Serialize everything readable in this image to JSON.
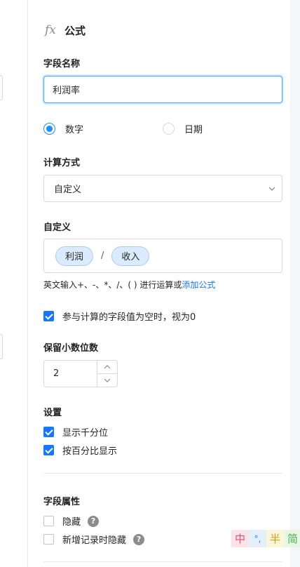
{
  "header": {
    "icon": "fx-icon",
    "fx_text": "fx",
    "title": "公式"
  },
  "field_name": {
    "label": "字段名称",
    "value": "利润率"
  },
  "type_options": [
    {
      "label": "数字",
      "selected": true
    },
    {
      "label": "日期",
      "selected": false
    }
  ],
  "calc": {
    "label": "计算方式",
    "value": "自定义"
  },
  "custom": {
    "label": "自定义",
    "tokens": [
      "利润",
      "收入"
    ],
    "operator": "/",
    "hint": "英文输入+、-、*、/、( ) 进行运算或",
    "hint_link": "添加公式"
  },
  "empty_as_zero": {
    "label": "参与计算的字段值为空时，视为0",
    "checked": true
  },
  "decimals": {
    "label": "保留小数位数",
    "value": "2"
  },
  "settings": {
    "label": "设置",
    "items": [
      {
        "label": "显示千分位",
        "checked": true
      },
      {
        "label": "按百分比显示",
        "checked": true
      }
    ]
  },
  "attributes": {
    "label": "字段属性",
    "items": [
      {
        "label": "隐藏",
        "checked": false,
        "help": "?"
      },
      {
        "label": "新增记录时隐藏",
        "checked": false,
        "help": "?"
      }
    ]
  },
  "ime_toolbar": [
    "中",
    "°,",
    "半",
    "简"
  ],
  "colors": {
    "accent": "#1677ff",
    "pill_bg": "#dbeafc",
    "border": "#d9d9d9"
  }
}
